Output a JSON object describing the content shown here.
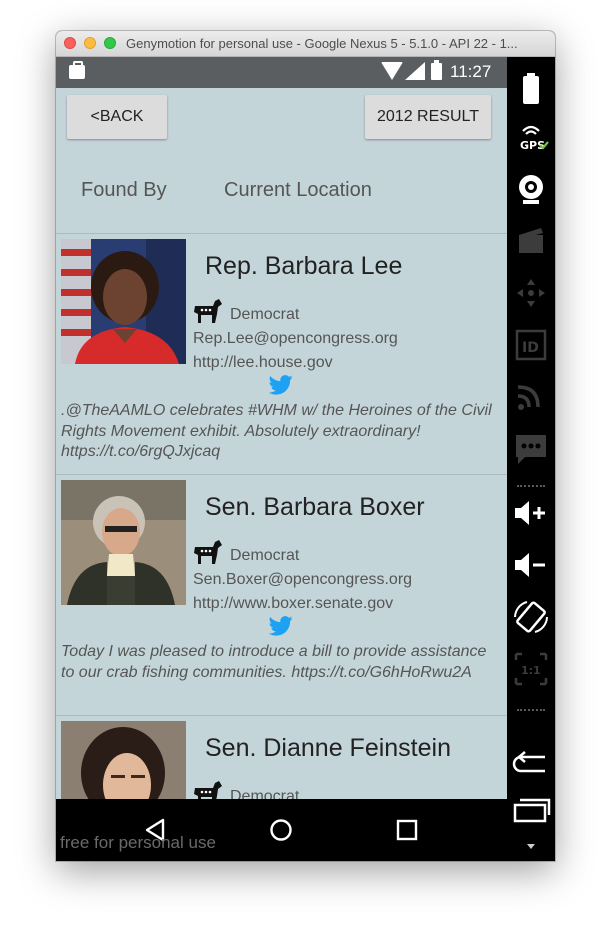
{
  "window": {
    "title": "Genymotion for personal use - Google Nexus 5 - 5.1.0 - API 22 - 1..."
  },
  "status_bar": {
    "time": "11:27"
  },
  "toolbar": {
    "back_label": "<BACK",
    "result_label": "2012 RESULT"
  },
  "filters": {
    "found_by": "Found By",
    "current_location": "Current Location"
  },
  "politicians": [
    {
      "name": "Rep. Barbara Lee",
      "party": "Democrat",
      "email": "Rep.Lee@opencongress.org",
      "website": "http://lee.house.gov",
      "tweet": ".@TheAAMLO celebrates #WHM w/ the Heroines of the Civil Rights Movement exhibit. Absolutely extraordinary! https://t.co/6rgQJxjcaq"
    },
    {
      "name": "Sen. Barbara Boxer",
      "party": "Democrat",
      "email": "Sen.Boxer@opencongress.org",
      "website": "http://www.boxer.senate.gov",
      "tweet": "Today I was pleased to introduce a bill to provide assistance to our crab fishing communities. https://t.co/G6hHoRwu2A"
    },
    {
      "name": "Sen. Dianne Feinstein",
      "party": "Democrat",
      "email": "",
      "website": "",
      "tweet": ""
    }
  ],
  "watermark": "free for personal use",
  "colors": {
    "screen_bg": "#c4d5da",
    "twitter": "#1da1f2",
    "status_bar": "#5a5e60"
  },
  "sidebar_icons": [
    "battery-icon",
    "gps-icon",
    "webcam-icon",
    "capture-icon",
    "dpad-icon",
    "id-icon",
    "rss-icon",
    "sms-icon",
    "volume-up-icon",
    "volume-down-icon",
    "rotate-icon",
    "pixel-perfect-icon",
    "back-icon",
    "recent-apps-icon"
  ]
}
